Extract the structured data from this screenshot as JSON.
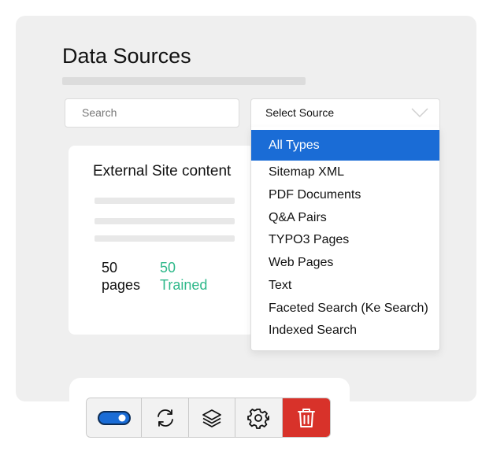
{
  "page": {
    "title": "Data Sources"
  },
  "search": {
    "placeholder": "Search"
  },
  "select": {
    "value": "Select Source",
    "options": [
      "All Types",
      "Sitemap XML",
      "PDF Documents",
      "Q&A Pairs",
      "TYPO3 Pages",
      "Web Pages",
      "Text",
      "Faceted Search (Ke Search)",
      "Indexed Search"
    ],
    "selected_option": "All Types"
  },
  "card": {
    "title": "External Site content",
    "pages_count": "50",
    "pages_label": "pages",
    "trained_count": "50",
    "trained_label": "Trained"
  },
  "toolbar": {
    "icons": [
      "toggle-icon",
      "sync-icon",
      "layers-icon",
      "gear-icon",
      "trash-icon"
    ],
    "toggle_on": true
  },
  "colors": {
    "accent": "#1a6cd6",
    "trained": "#2eb88a",
    "delete": "#d8322a"
  }
}
